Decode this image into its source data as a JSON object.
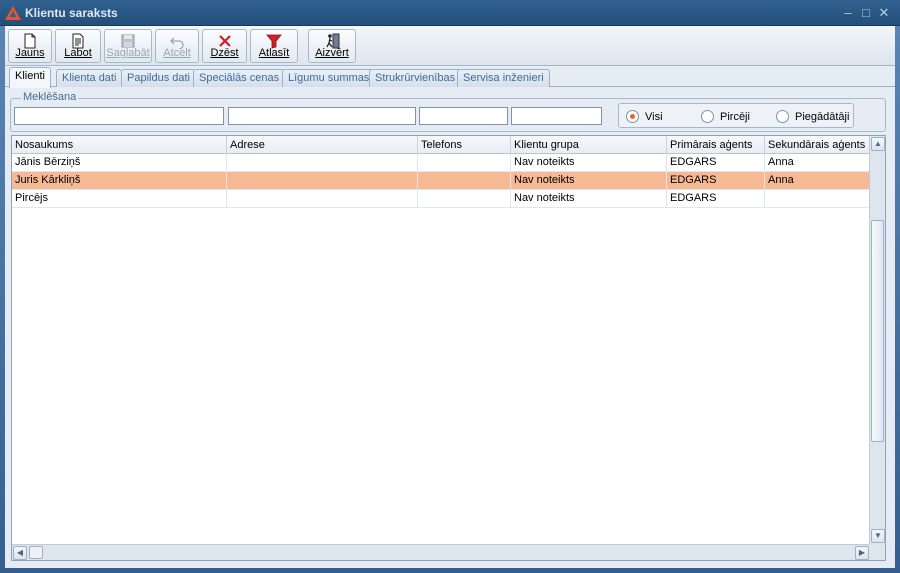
{
  "window": {
    "title": "Klientu saraksts"
  },
  "toolbar": {
    "new_label": "Jauns",
    "edit_label": "Labot",
    "save_label": "Saglabāt",
    "cancel_label": "Atcelt",
    "delete_label": "Dzēst",
    "filter_label": "Atlasīt",
    "close_label": "Aizvērt"
  },
  "tabs": [
    {
      "label": "Klienti"
    },
    {
      "label": "Klienta dati"
    },
    {
      "label": "Papildus dati"
    },
    {
      "label": "Speciālās cenas"
    },
    {
      "label": "Līgumu summas"
    },
    {
      "label": "Strukrūrvienības"
    },
    {
      "label": "Servisa inženieri"
    }
  ],
  "search": {
    "legend": "Meklēšana",
    "field1": "",
    "field2": "",
    "field3": "",
    "field4": "",
    "radios": [
      {
        "label": "Visi",
        "checked": true
      },
      {
        "label": "Pircēji",
        "checked": false
      },
      {
        "label": "Piegādātāji",
        "checked": false
      }
    ]
  },
  "grid": {
    "columns": [
      "Nosaukums",
      "Adrese",
      "Telefons",
      "Klientu grupa",
      "Primārais aģents",
      "Sekundārais aģents"
    ],
    "rows": [
      {
        "cells": [
          "Jānis Bērziņš",
          "",
          "",
          "Nav noteikts",
          "EDGARS",
          "Anna"
        ],
        "selected": false
      },
      {
        "cells": [
          "Juris Kārkliņš",
          "",
          "",
          "Nav noteikts",
          "EDGARS",
          "Anna"
        ],
        "selected": true
      },
      {
        "cells": [
          "Pircējs",
          "",
          "",
          "Nav noteikts",
          "EDGARS",
          ""
        ],
        "selected": false
      }
    ]
  },
  "colors": {
    "selected_row": "#f7b894",
    "radio_dot": "#e8642c",
    "title_bar": "#30618f"
  },
  "icons": {
    "app": "app-logo-icon",
    "new": "new-document-icon",
    "edit": "edit-document-icon",
    "save": "floppy-disk-icon",
    "cancel": "undo-icon",
    "delete": "red-x-icon",
    "filter": "funnel-icon",
    "close": "exit-icon"
  }
}
